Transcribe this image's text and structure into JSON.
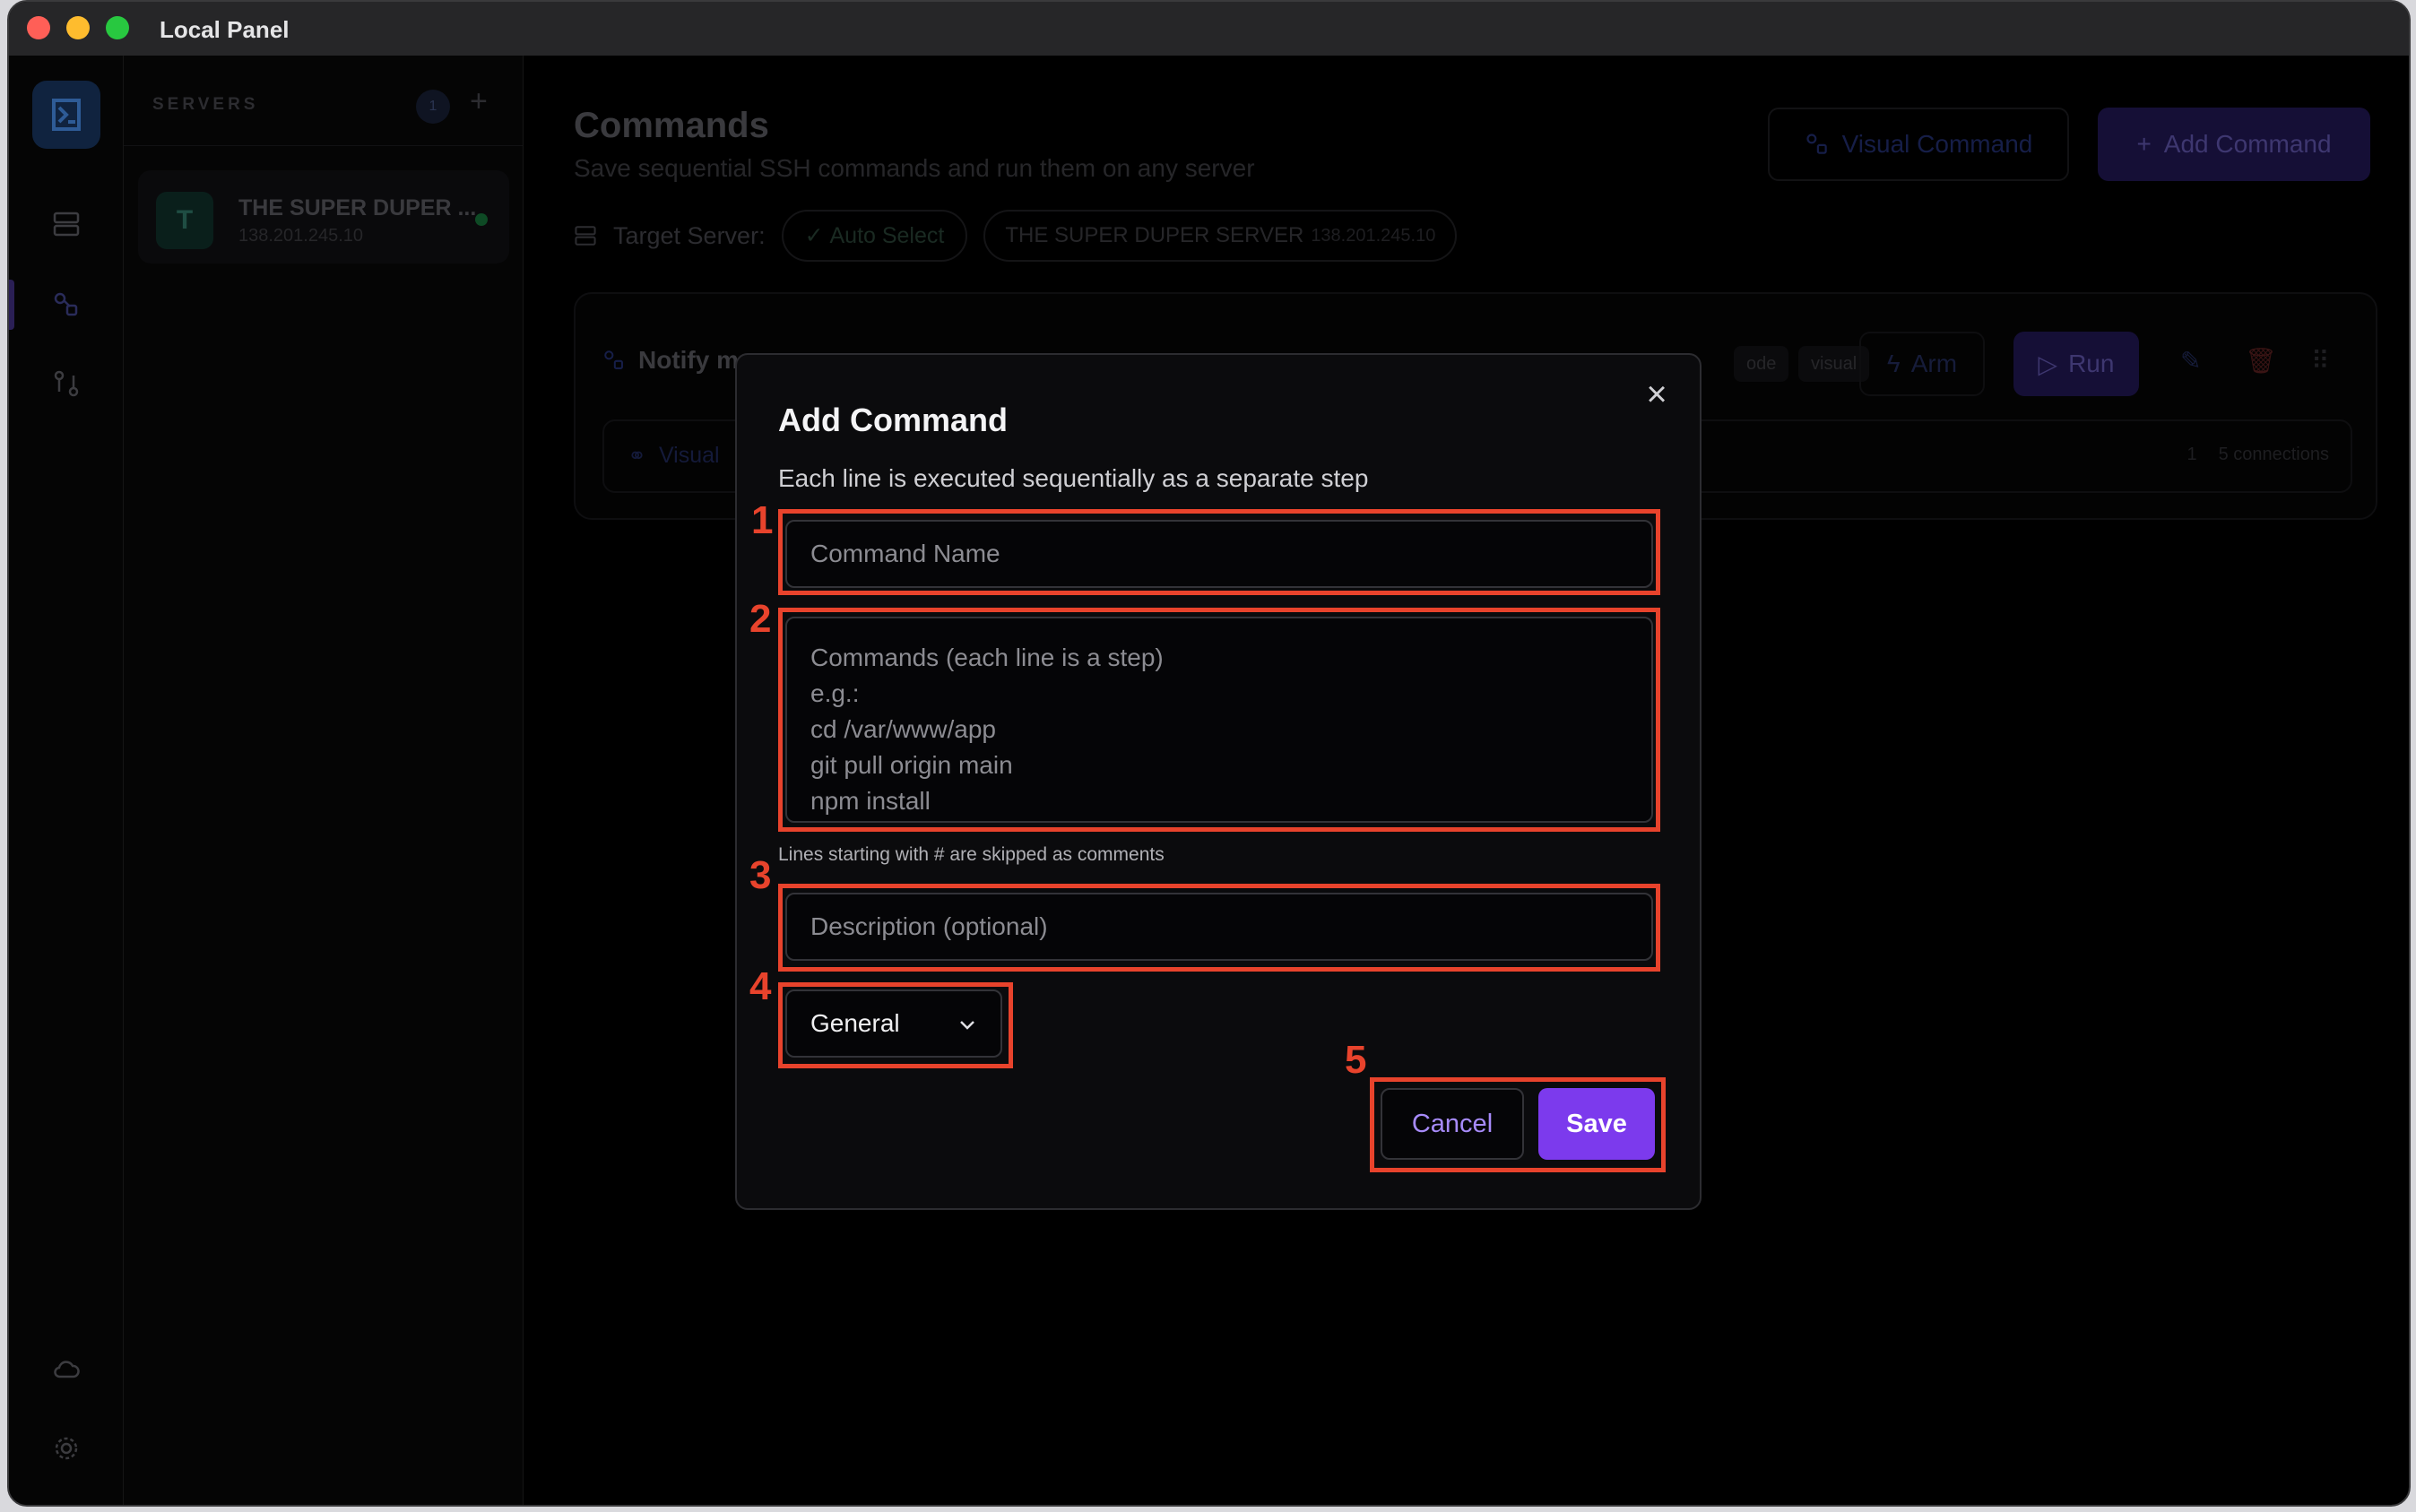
{
  "window": {
    "title": "Local Panel"
  },
  "sidebar": {
    "header": "SERVERS",
    "count": "1",
    "add_symbol": "+",
    "servers": [
      {
        "avatar": "T",
        "name": "THE SUPER DUPER ...",
        "ip": "138.201.245.10",
        "status": "online"
      }
    ]
  },
  "main": {
    "title": "Commands",
    "subtitle": "Save sequential SSH commands and run them on any server",
    "visual_button": "Visual Command",
    "add_button": "Add Command",
    "target_label": "Target Server:",
    "auto_select": "Auto Select",
    "server_chip_name": "THE SUPER DUPER SERVER",
    "server_chip_ip": "138.201.245.10",
    "card": {
      "name": "Notify m",
      "tag_node": "ode",
      "tag_visual": "visual",
      "arm": "Arm",
      "run": "Run",
      "sub_label": "Visual",
      "conn_count": "1",
      "connections": "5 connections"
    }
  },
  "modal": {
    "title": "Add Command",
    "subtitle": "Each line is executed sequentially as a separate step",
    "name_placeholder": "Command Name",
    "commands_placeholder": "Commands (each line is a step)\ne.g.:\ncd /var/www/app\ngit pull origin main\nnpm install",
    "hint": "Lines starting with # are skipped as comments",
    "description_placeholder": "Description (optional)",
    "category": "General",
    "cancel": "Cancel",
    "save": "Save"
  },
  "annotations": [
    "1",
    "2",
    "3",
    "4",
    "5"
  ],
  "colors": {
    "accent": "#7c3aed",
    "annotation": "#e8432c",
    "background": "#000000"
  }
}
